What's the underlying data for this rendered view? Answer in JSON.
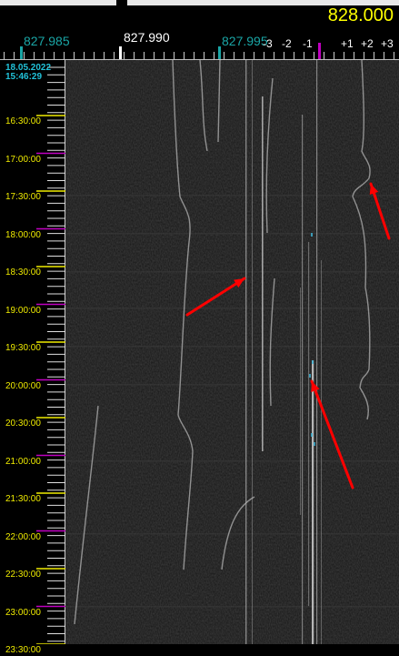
{
  "center_frequency": "828.000",
  "frequency_labels": {
    "left": "827.985",
    "middle": "827.990",
    "right": "827.995"
  },
  "offset_labels": [
    "-3",
    "-2",
    "-1",
    "+1",
    "+2",
    "+3"
  ],
  "date": "18.05.2022",
  "start_time": "15:46:29",
  "time_labels": [
    "16:30:00",
    "17:00:00",
    "17:30:00",
    "18:00:00",
    "18:30:00",
    "19:00:00",
    "19:30:00",
    "20:00:00",
    "20:30:00",
    "21:00:00",
    "21:30:00",
    "22:00:00",
    "22:30:00",
    "23:00:00",
    "23:30:00"
  ],
  "colors": {
    "center_frequency": "#ffff00",
    "frequency_label_teal": "#1aa6a6",
    "time_label": "#f0ec00",
    "date_label": "#21c1d8",
    "hour_tick": "#c000c0",
    "half_hour_tick": "#f0ec00",
    "annotation_arrow": "#ff0000",
    "waterfall_background": "#151515"
  }
}
